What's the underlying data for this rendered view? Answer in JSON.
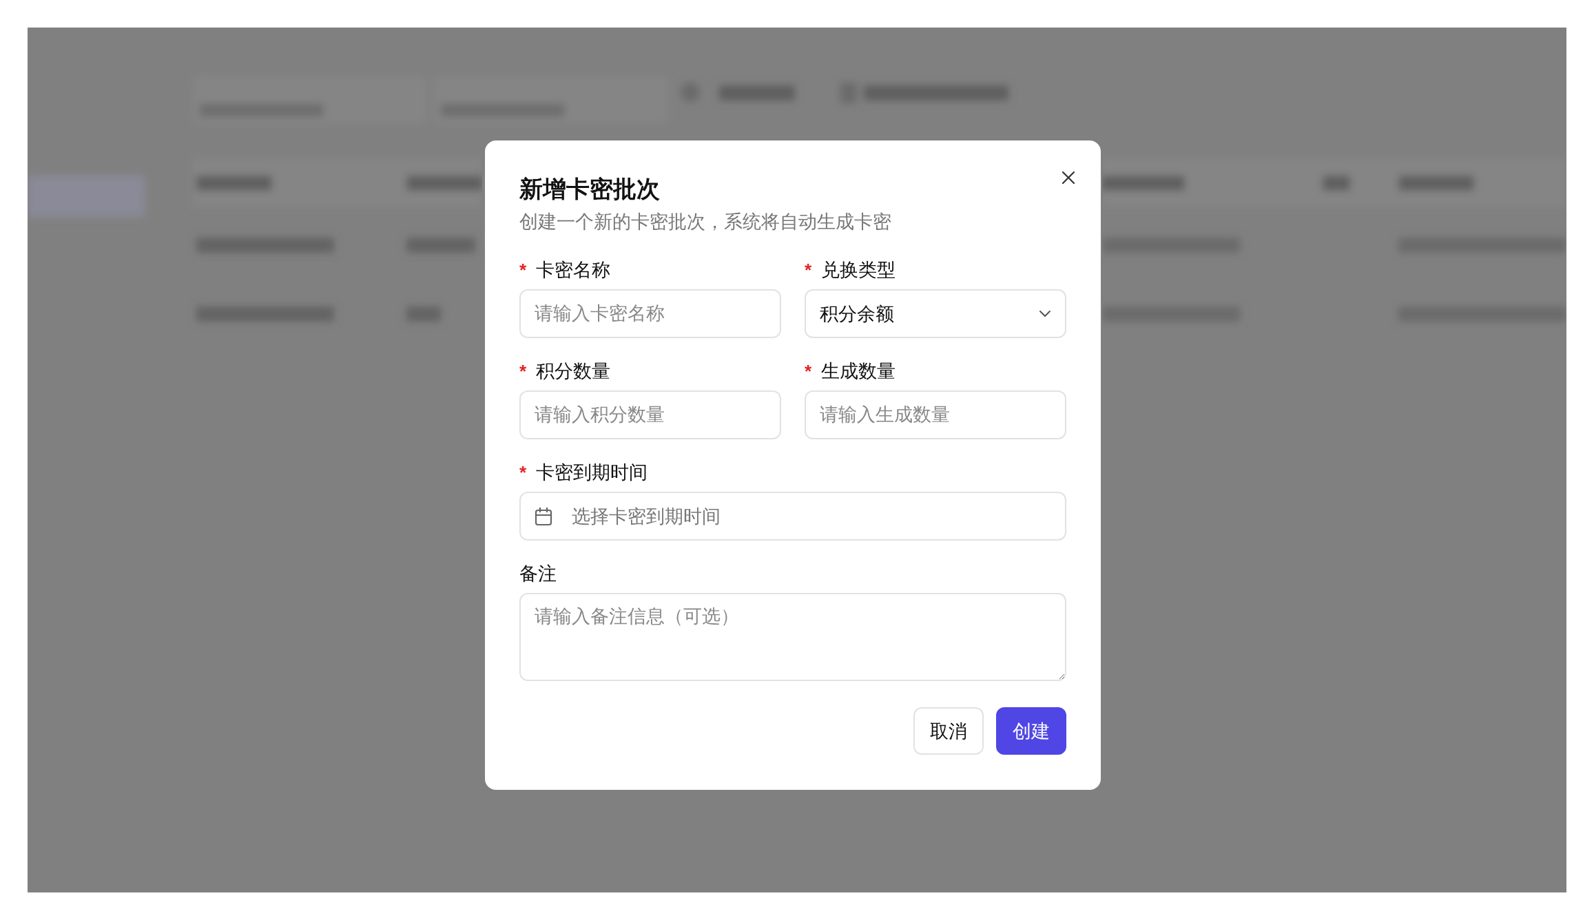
{
  "dialog": {
    "title": "新增卡密批次",
    "subtitle": "创建一个新的卡密批次，系统将自动生成卡密",
    "fields": [
      {
        "kind": "text",
        "marker": "*",
        "label": "卡密名称",
        "placeholder": "请输入卡密名称",
        "wide": false
      },
      {
        "kind": "select",
        "marker": "*",
        "label": "兑换类型",
        "value": "积分余额",
        "wide": false
      },
      {
        "kind": "text",
        "marker": "*",
        "label": "积分数量",
        "placeholder": "请输入积分数量",
        "wide": false
      },
      {
        "kind": "text",
        "marker": "*",
        "label": "生成数量",
        "placeholder": "请输入生成数量",
        "wide": false
      },
      {
        "kind": "date",
        "marker": "*",
        "label": "卡密到期时间",
        "placeholder": "选择卡密到期时间",
        "wide": true
      },
      {
        "kind": "textarea",
        "label": "备注",
        "placeholder": "请输入备注信息（可选）",
        "wide": true
      }
    ],
    "buttons": [
      {
        "kind": "secondary",
        "label": "取消"
      },
      {
        "kind": "primary",
        "label": "创建"
      }
    ]
  }
}
